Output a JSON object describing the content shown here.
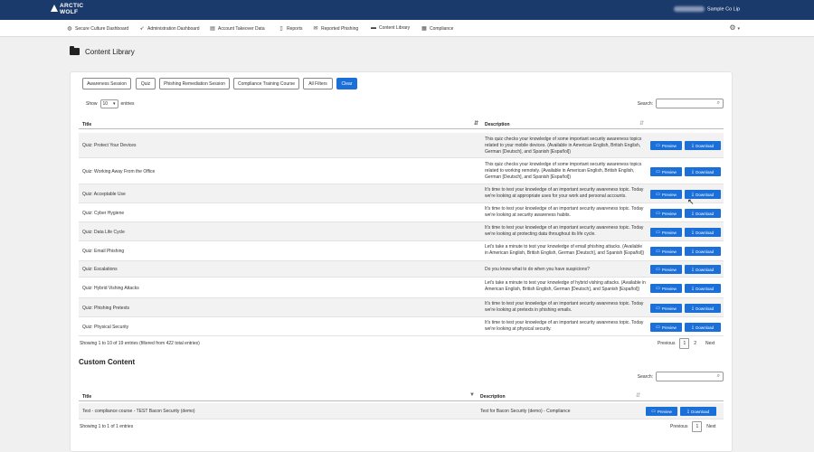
{
  "header": {
    "logo_line1": "ARCTIC",
    "logo_line2": "WOLF",
    "account_name": "Sample Co Lip"
  },
  "nav": {
    "items": [
      {
        "label": "Secure Culture Dashboard",
        "icon": "globe-icon"
      },
      {
        "label": "Administration Dashboard",
        "icon": "rocket-icon"
      },
      {
        "label": "Account Takeover Data",
        "icon": "keyboard-icon"
      },
      {
        "label": "Reports",
        "icon": "document-icon"
      },
      {
        "label": "Reported Phishing",
        "icon": "envelope-icon"
      },
      {
        "label": "Content Library",
        "icon": "folder-icon"
      },
      {
        "label": "Compliance",
        "icon": "table-icon"
      }
    ]
  },
  "page": {
    "title": "Content Library"
  },
  "filters": [
    {
      "label": "Awareness Session"
    },
    {
      "label": "Quiz"
    },
    {
      "label": "Phishing Remediation Session"
    },
    {
      "label": "Compliance Training Course"
    },
    {
      "label": "All Filters"
    },
    {
      "label": "Clear"
    }
  ],
  "length_control": {
    "prefix": "Show",
    "value": "10",
    "suffix": "entries"
  },
  "search": {
    "label": "Search:"
  },
  "table": {
    "columns": {
      "title": "Title",
      "description": "Description"
    },
    "preview_label": "Preview",
    "download_label": "Download",
    "rows": [
      {
        "title": "Quiz: Protect Your Devices",
        "desc": "This quiz checks your knowledge of some important security awareness topics related to your mobile devices. (Available in American English, British English, German [Deutsch], and Spanish [Español])"
      },
      {
        "title": "Quiz: Working Away From the Office",
        "desc": "This quiz checks your knowledge of some important security awareness topics related to working remotely. (Available in American English, British English, German [Deutsch], and Spanish [Español])"
      },
      {
        "title": "Quiz: Acceptable Use",
        "desc": "It's time to test your knowledge of an important security awareness topic. Today we're looking at appropriate uses for your work and personal accounts."
      },
      {
        "title": "Quiz: Cyber Hygiene",
        "desc": "It's time to test your knowledge of an important security awareness topic. Today we're looking at security awareness habits."
      },
      {
        "title": "Quiz: Data Life Cycle",
        "desc": "It's time to test your knowledge of an important security awareness topic. Today we're looking at protecting data throughout its life cycle."
      },
      {
        "title": "Quiz: Email Phishing",
        "desc": "Let's take a minute to test your knowledge of email phishing attacks. (Available in American English, British English, German [Deutsch], and Spanish [Español])"
      },
      {
        "title": "Quiz: Escalations",
        "desc": "Do you know what to do when you have suspicions?"
      },
      {
        "title": "Quiz: Hybrid Vishing Attacks",
        "desc": "Let's take a minute to test your knowledge of hybrid vishing attacks. (Available in American English, British English, German [Deutsch], and Spanish [Español])"
      },
      {
        "title": "Quiz: Phishing Pretexts",
        "desc": "It's time to test your knowledge of an important security awareness topic. Today we're looking at pretexts in phishing emails."
      },
      {
        "title": "Quiz: Physical Security",
        "desc": "It's time to test your knowledge of an important security awareness topic. Today we're looking at physical security."
      }
    ],
    "info": "Showing 1 to 10 of 19 entries (filtered from 422 total entries)",
    "pager": {
      "previous": "Previous",
      "page1": "1",
      "page2": "2",
      "next": "Next"
    }
  },
  "custom": {
    "title": "Custom Content",
    "search_label": "Search:",
    "columns": {
      "title": "Title",
      "description": "Description"
    },
    "rows": [
      {
        "title": "Test - compliance course - TEST Bacon Security (demo)",
        "desc": "Test for Bacon Security (demo) - Compliance"
      }
    ],
    "info": "Showing 1 to 1 of 1 entries",
    "pager": {
      "previous": "Previous",
      "page1": "1",
      "next": "Next"
    }
  }
}
